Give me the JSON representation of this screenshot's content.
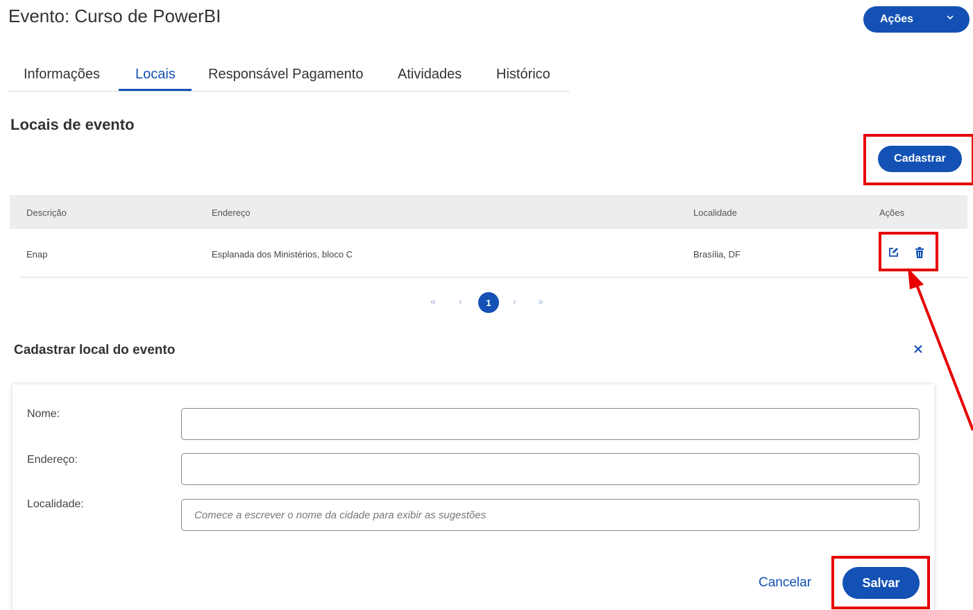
{
  "page": {
    "title": "Evento: Curso de PowerBI"
  },
  "header": {
    "actions_label": "Ações"
  },
  "tabs": [
    {
      "label": "Informações"
    },
    {
      "label": "Locais"
    },
    {
      "label": "Responsável Pagamento"
    },
    {
      "label": "Atividades"
    },
    {
      "label": "Histórico"
    }
  ],
  "active_tab": "Locais",
  "section": {
    "title": "Locais de evento",
    "add_button_label": "Cadastrar"
  },
  "table": {
    "headers": [
      "Descrição",
      "Endereço",
      "Localidade",
      "Ações"
    ],
    "rows": [
      {
        "descricao": "Enap",
        "endereco": "Esplanada dos Ministérios, bloco C",
        "localidade": "Brasília, DF"
      }
    ]
  },
  "pagination": {
    "first": "«",
    "prev": "‹",
    "current": "1",
    "next": "›",
    "last": "»"
  },
  "form": {
    "title": "Cadastrar local do evento",
    "close_icon": "close-icon",
    "fields": [
      {
        "label": "Nome:",
        "value": "",
        "placeholder": ""
      },
      {
        "label": "Endereço:",
        "value": "",
        "placeholder": ""
      },
      {
        "label": "Localidade:",
        "value": "",
        "placeholder": "Comece a escrever o nome da cidade para exibir as sugestões"
      }
    ],
    "cancel_label": "Cancelar",
    "save_label": "Salvar"
  },
  "colors": {
    "primary": "#1351b4",
    "highlight": "#e60000",
    "header_bg": "#ededed"
  }
}
